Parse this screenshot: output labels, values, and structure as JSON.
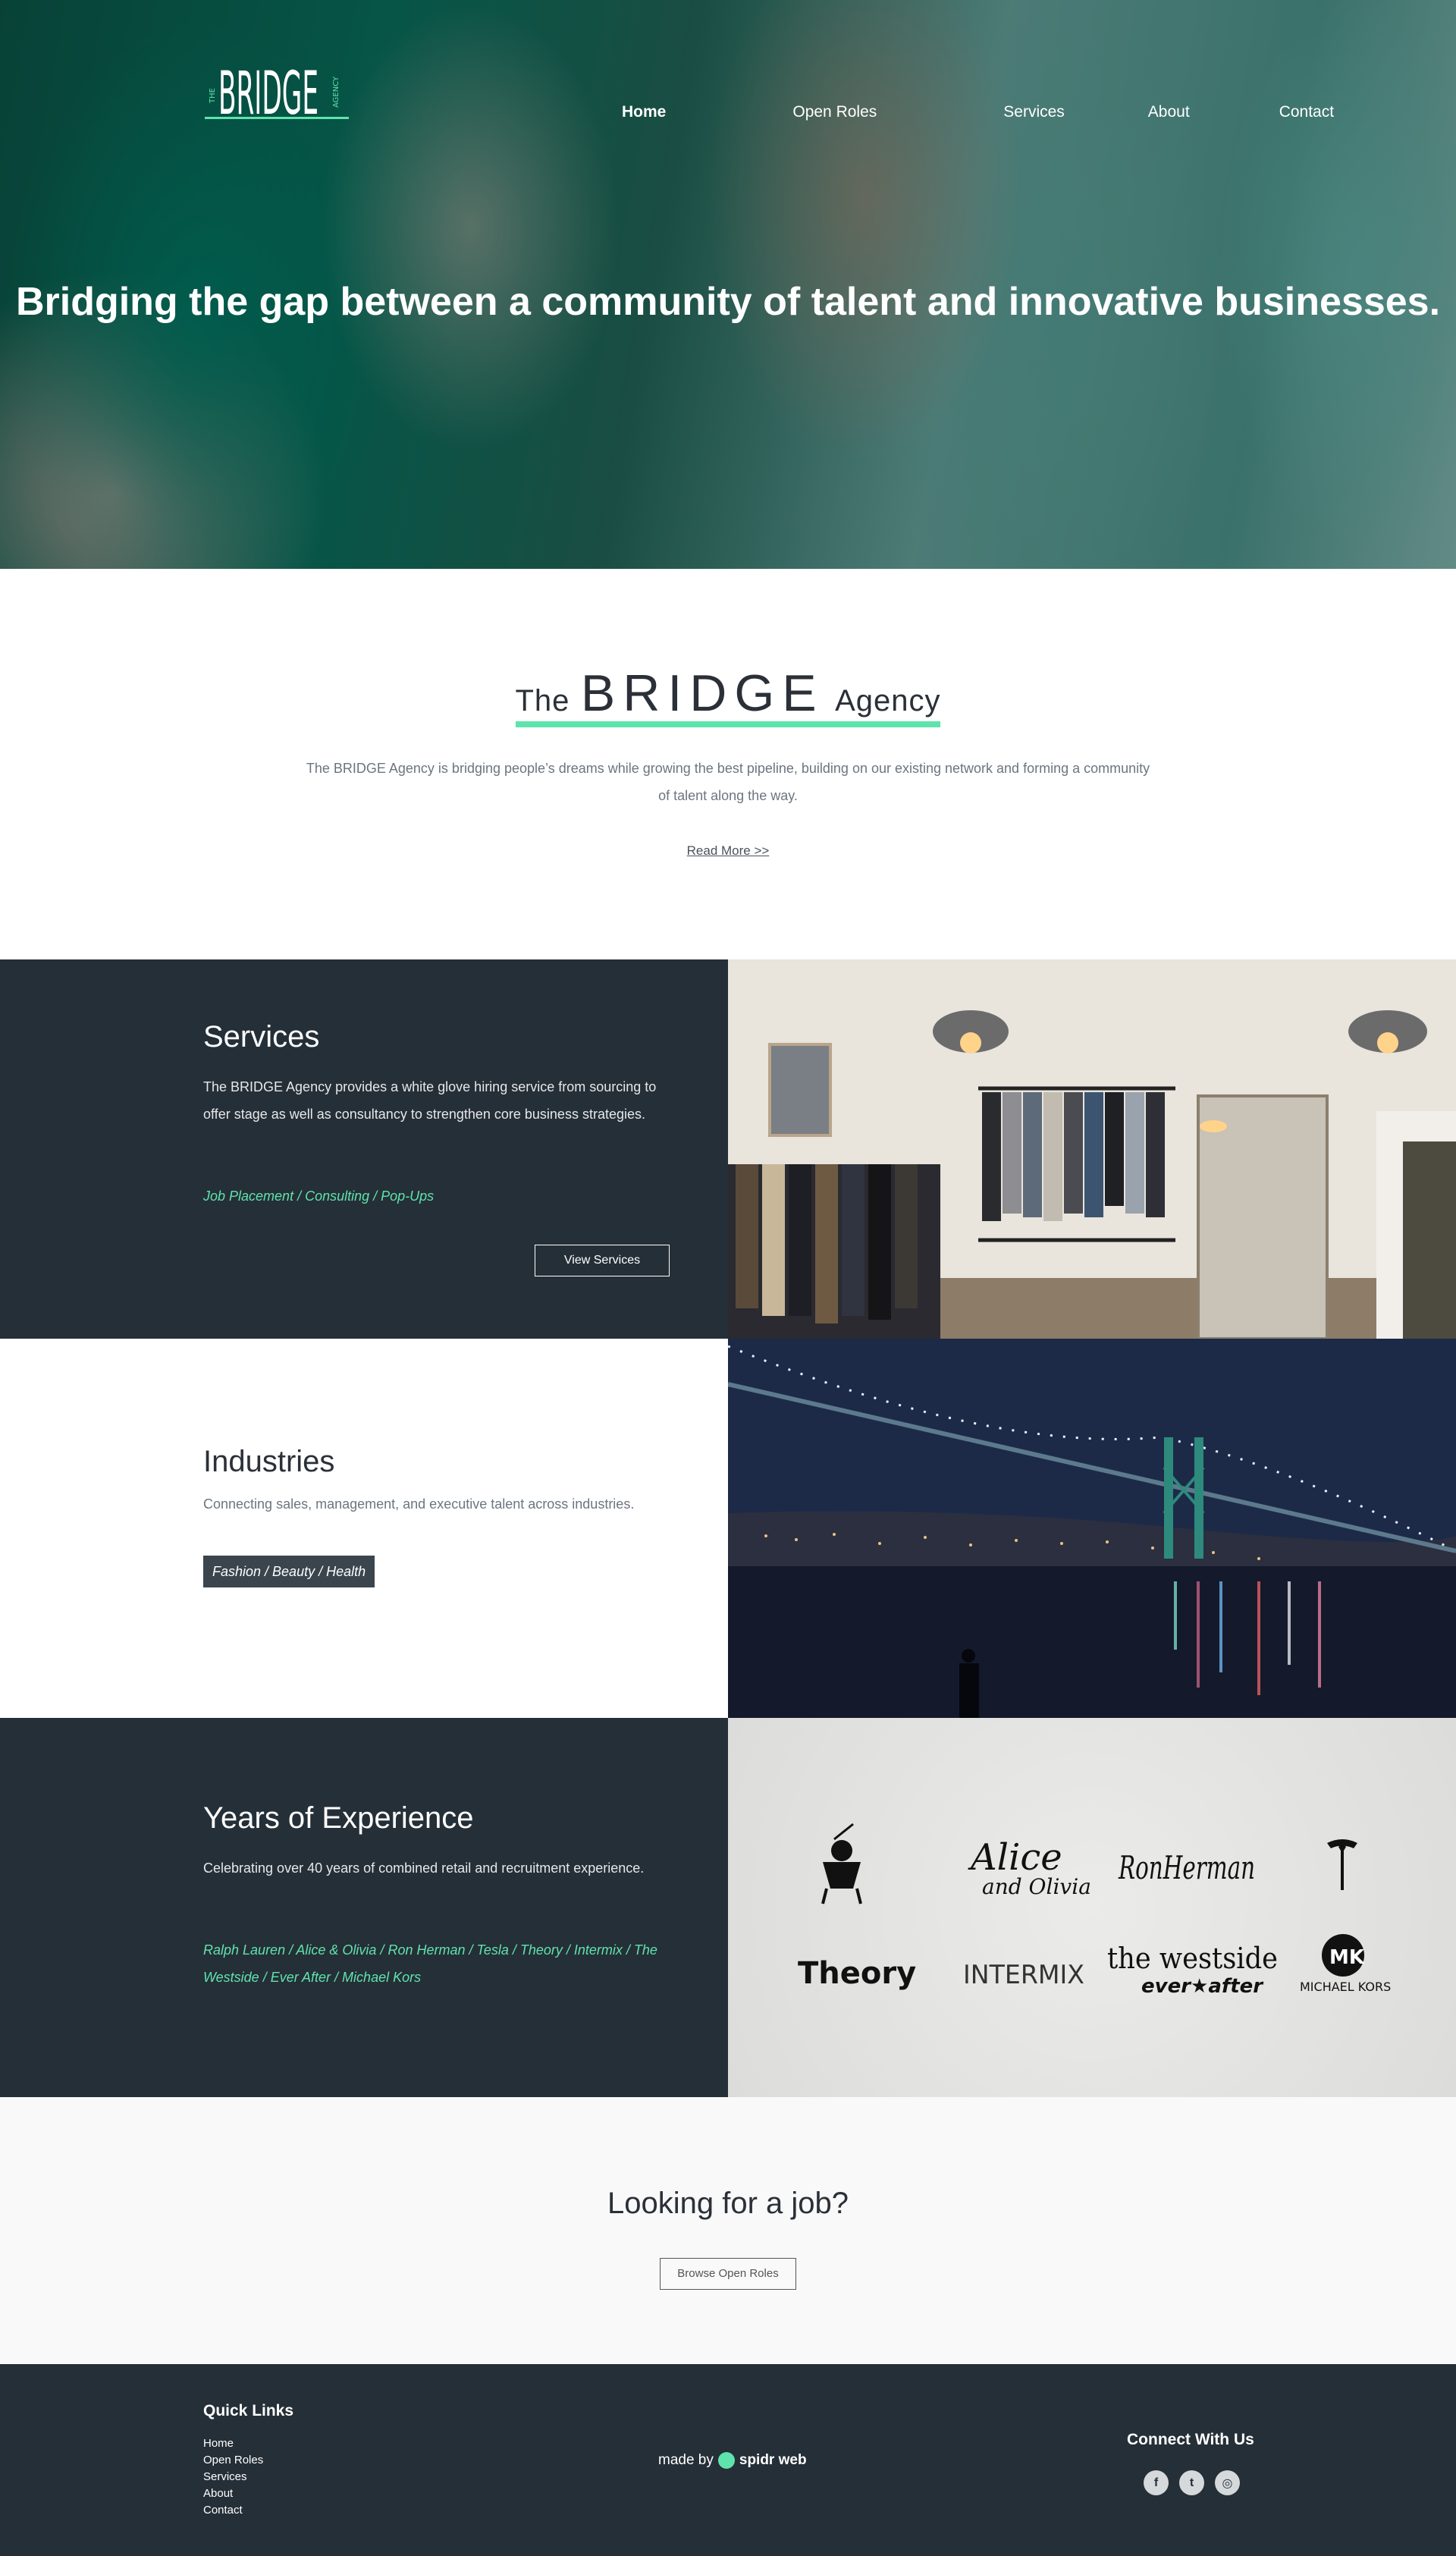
{
  "nav": {
    "items": [
      {
        "label": "Home",
        "active": true
      },
      {
        "label": "Open Roles"
      },
      {
        "label": "Services"
      },
      {
        "label": "About"
      },
      {
        "label": "Contact"
      }
    ]
  },
  "logo": {
    "text": "BRIDGE",
    "small_left": "THE",
    "small_right": "AGENCY"
  },
  "hero": {
    "headline": "Bridging the gap between a community of talent and innovative businesses."
  },
  "intro": {
    "title_the": "The",
    "title_brand": "BRIDGE",
    "title_agency": "Agency",
    "body": "The BRIDGE Agency is bridging people’s dreams while growing the best pipeline, building on our existing network and forming a community of talent along the way.",
    "read_more": "Read More >>"
  },
  "services": {
    "title": "Services",
    "body": "The BRIDGE Agency provides a white glove hiring service from sourcing to offer stage as well as consultancy to strengthen core business strategies.",
    "tags": "Job Placement / Consulting / Pop-Ups",
    "button": "View Services"
  },
  "industries": {
    "title": "Industries",
    "body": "Connecting sales, management, and executive talent across industries.",
    "tag": "Fashion / Beauty / Health"
  },
  "experience": {
    "title": "Years of Experience",
    "body": "Celebrating over 40 years of combined retail and recruitment experience.",
    "tags": "Ralph Lauren / Alice & Olivia / Ron Herman / Tesla / Theory / Intermix / The Westside / Ever After / Michael Kors",
    "logos": {
      "alice": "Alice",
      "olivia": "and Olivia",
      "ron": "RonHerman",
      "theory": "Theory",
      "intermix": "INTERMIX",
      "westside": "the westside",
      "everafter": "ever★after",
      "mk_mark": "MK",
      "mk": "MICHAEL KORS"
    }
  },
  "cta": {
    "title": "Looking for a job?",
    "button": "Browse Open Roles"
  },
  "footer": {
    "quick_links_title": "Quick Links",
    "quick_links": [
      "Home",
      "Open Roles",
      "Services",
      "About",
      "Contact"
    ],
    "made_by": "made by",
    "made_brand": "spidr web",
    "connect_title": "Connect With Us",
    "social": [
      {
        "icon": "facebook-icon",
        "glyph": "f"
      },
      {
        "icon": "twitter-icon",
        "glyph": "t"
      },
      {
        "icon": "instagram-icon",
        "glyph": "◎"
      }
    ]
  },
  "colors": {
    "accent": "#5fe3ad",
    "dark": "#252f37",
    "text_muted": "#6c7580"
  }
}
